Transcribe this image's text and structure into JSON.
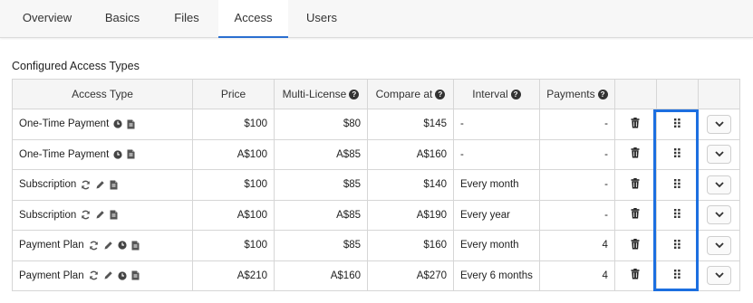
{
  "tabs": [
    {
      "label": "Overview"
    },
    {
      "label": "Basics"
    },
    {
      "label": "Files"
    },
    {
      "label": "Access",
      "active": true
    },
    {
      "label": "Users"
    }
  ],
  "section_title": "Configured Access Types",
  "columns": {
    "access_type": "Access Type",
    "price": "Price",
    "multi_license": "Multi-License",
    "compare_at": "Compare at",
    "interval": "Interval",
    "payments": "Payments",
    "help_glyph": "?"
  },
  "rows": [
    {
      "type": "One-Time Payment",
      "icons": [
        "clock-icon",
        "file-icon"
      ],
      "price": "$100",
      "multi": "$80",
      "compare": "$145",
      "interval": "-",
      "payments": "-"
    },
    {
      "type": "One-Time Payment",
      "icons": [
        "clock-icon",
        "file-icon"
      ],
      "price": "A$100",
      "multi": "A$85",
      "compare": "A$160",
      "interval": "-",
      "payments": "-"
    },
    {
      "type": "Subscription",
      "icons": [
        "refresh-icon",
        "pencil-icon",
        "file-icon"
      ],
      "price": "$100",
      "multi": "$85",
      "compare": "$140",
      "interval": "Every month",
      "payments": "-"
    },
    {
      "type": "Subscription",
      "icons": [
        "refresh-icon",
        "pencil-icon",
        "file-icon"
      ],
      "price": "A$100",
      "multi": "A$85",
      "compare": "A$190",
      "interval": "Every year",
      "payments": "-"
    },
    {
      "type": "Payment Plan",
      "icons": [
        "refresh-icon",
        "pencil-icon",
        "clock-icon",
        "file-icon"
      ],
      "price": "$100",
      "multi": "$85",
      "compare": "$160",
      "interval": "Every month",
      "payments": "4"
    },
    {
      "type": "Payment Plan",
      "icons": [
        "refresh-icon",
        "pencil-icon",
        "clock-icon",
        "file-icon"
      ],
      "price": "A$210",
      "multi": "A$160",
      "compare": "A$270",
      "interval": "Every 6 months",
      "payments": "4"
    }
  ],
  "row_actions": [
    "trash-icon",
    "drag-handle-icon",
    "chevron-down-icon"
  ],
  "colors": {
    "accent": "#2a6fd0",
    "highlight": "#1c6fe0"
  }
}
